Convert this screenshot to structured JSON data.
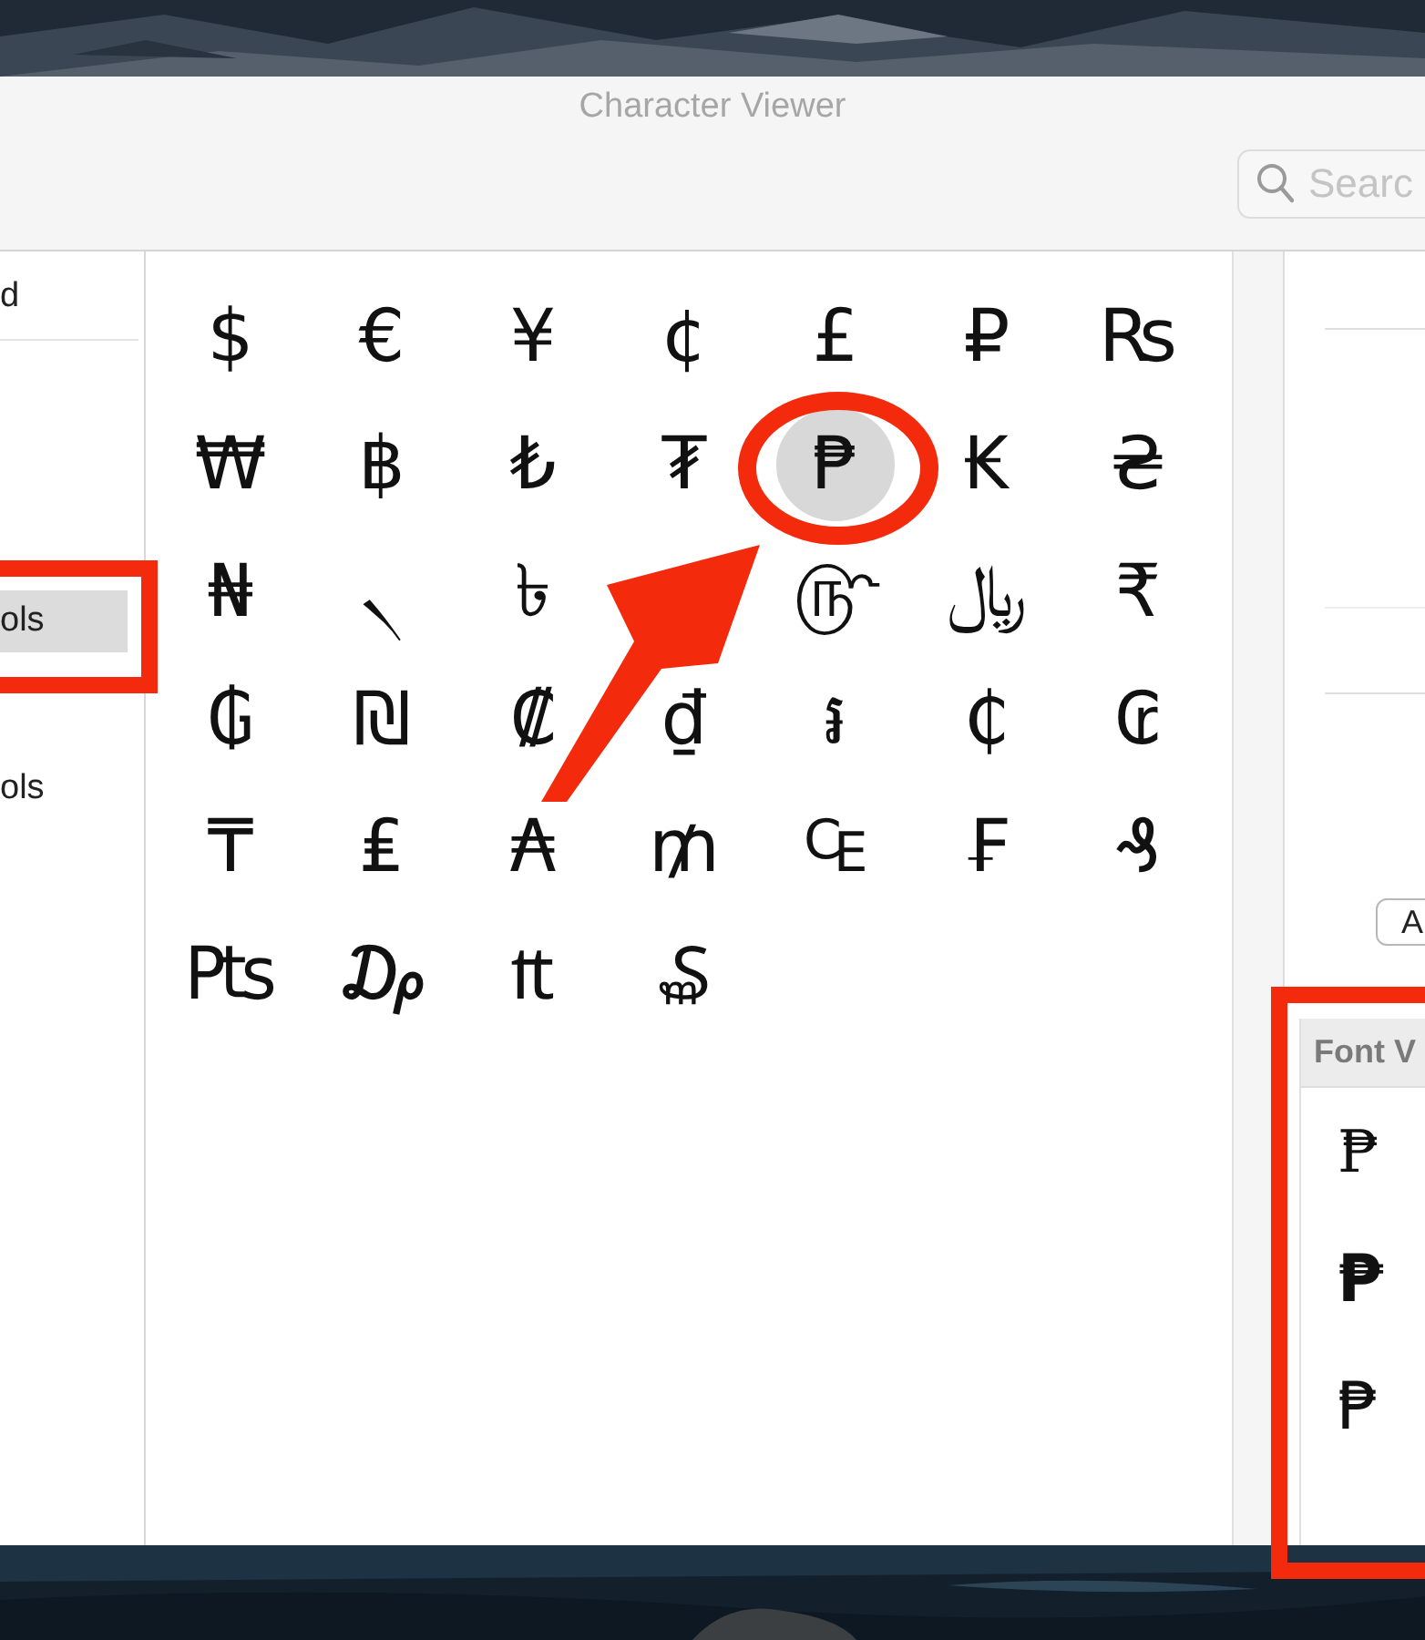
{
  "window": {
    "title": "Character Viewer"
  },
  "search": {
    "placeholder": "Searc"
  },
  "sidebar": {
    "items": [
      {
        "label": "d",
        "selected": false
      },
      {
        "label": "ols",
        "selected": true
      },
      {
        "label": "ols",
        "selected": false
      }
    ]
  },
  "characters": [
    {
      "char": "$",
      "selected": false
    },
    {
      "char": "€",
      "selected": false
    },
    {
      "char": "¥",
      "selected": false
    },
    {
      "char": "¢",
      "selected": false
    },
    {
      "char": "£",
      "selected": false
    },
    {
      "char": "₽",
      "selected": false
    },
    {
      "char": "₨",
      "selected": false
    },
    {
      "char": "₩",
      "selected": false
    },
    {
      "char": "฿",
      "selected": false
    },
    {
      "char": "₺",
      "selected": false
    },
    {
      "char": "₮",
      "selected": false
    },
    {
      "char": "₱",
      "selected": true
    },
    {
      "char": "₭",
      "selected": false
    },
    {
      "char": "₴",
      "selected": false
    },
    {
      "char": "₦",
      "selected": false
    },
    {
      "char": "৲",
      "selected": false
    },
    {
      "char": "৳",
      "selected": false
    },
    {
      "char": "௹",
      "selected": false
    },
    {
      "char": "﷼",
      "selected": false
    },
    {
      "char": "₹",
      "selected": false
    },
    {
      "char": "₲",
      "selected": false
    },
    {
      "char": "₪",
      "selected": false
    },
    {
      "char": "₡",
      "selected": false
    },
    {
      "char": "₫",
      "selected": false
    },
    {
      "char": "៛",
      "selected": false
    },
    {
      "char": "₵",
      "selected": false
    },
    {
      "char": "₢",
      "selected": false
    },
    {
      "char": "₸",
      "selected": false
    },
    {
      "char": "₤",
      "selected": false
    },
    {
      "char": "₳",
      "selected": false
    },
    {
      "char": "₥",
      "selected": false
    },
    {
      "char": "₠",
      "selected": false
    },
    {
      "char": "₣",
      "selected": false
    },
    {
      "char": "₰",
      "selected": false
    },
    {
      "char": "₧",
      "selected": false
    },
    {
      "char": "₯",
      "selected": false
    },
    {
      "char": "₶",
      "selected": false
    },
    {
      "char": "₷",
      "selected": false
    }
  ],
  "details": {
    "button": "A"
  },
  "font_variation": {
    "title": "Font V",
    "glyphs": [
      "₱",
      "₱",
      "₱"
    ]
  }
}
